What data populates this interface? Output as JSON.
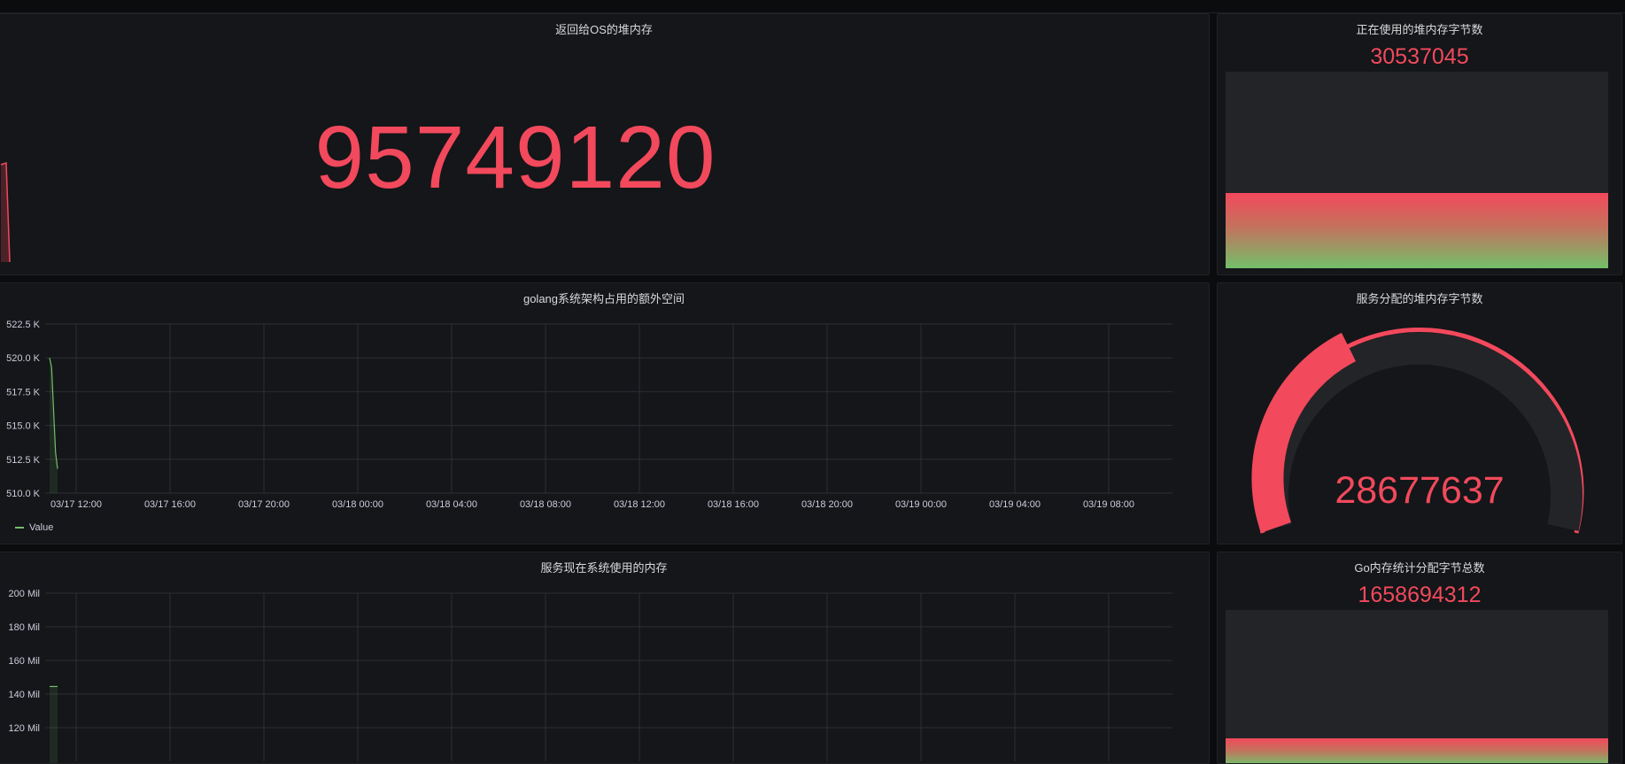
{
  "colors": {
    "red": "#f2495c",
    "green": "#73bf69",
    "panel_bg": "#141619",
    "grid": "#2c2e33"
  },
  "panels": {
    "returned_heap": {
      "title": "返回给OS的堆内存",
      "value": "95749120"
    },
    "in_use_heap": {
      "title": "正在使用的堆内存字节数",
      "value": "30537045",
      "fill_fraction": 0.38
    },
    "golang_extra": {
      "title": "golang系统架构占用的额外空间",
      "legend": "Value"
    },
    "allocated_heap": {
      "title": "服务分配的堆内存字节数",
      "value": "28677637",
      "gauge_fraction": 0.22
    },
    "sys_memory": {
      "title": "服务现在系统使用的内存"
    },
    "go_total_alloc": {
      "title": "Go内存统计分配字节总数",
      "value": "1658694312",
      "fill_fraction": 0.18
    }
  },
  "chart_data": [
    {
      "type": "line",
      "title": "golang系统架构占用的额外空间",
      "x_ticks": [
        "03/17 12:00",
        "03/17 16:00",
        "03/17 20:00",
        "03/18 00:00",
        "03/18 04:00",
        "03/18 08:00",
        "03/18 12:00",
        "03/18 16:00",
        "03/18 20:00",
        "03/19 00:00",
        "03/19 04:00",
        "03/19 08:00"
      ],
      "y_ticks": [
        "510.0 K",
        "512.5 K",
        "515.0 K",
        "517.5 K",
        "520.0 K",
        "522.5 K"
      ],
      "ylim": [
        510000,
        522500
      ],
      "series": [
        {
          "name": "Value",
          "x": [
            0.0,
            0.05,
            0.15,
            0.2
          ],
          "values": [
            520000,
            519300,
            513000,
            511800
          ]
        }
      ],
      "legend": "bottom-left",
      "grid": true
    },
    {
      "type": "area",
      "title": "服务现在系统使用的内存",
      "x_ticks": [
        "03/17 12:00",
        "03/17 16:00",
        "03/17 20:00",
        "03/18 00:00",
        "03/18 04:00",
        "03/18 08:00",
        "03/18 12:00",
        "03/18 16:00",
        "03/18 20:00",
        "03/19 00:00",
        "03/19 04:00",
        "03/19 08:00"
      ],
      "y_ticks": [
        "120 Mil",
        "140 Mil",
        "160 Mil",
        "180 Mil",
        "200 Mil"
      ],
      "ylim": [
        100000000,
        200000000
      ],
      "series": [
        {
          "x": [
            0.0,
            0.2
          ],
          "values": [
            144500000,
            144500000
          ]
        }
      ],
      "grid": true
    }
  ]
}
